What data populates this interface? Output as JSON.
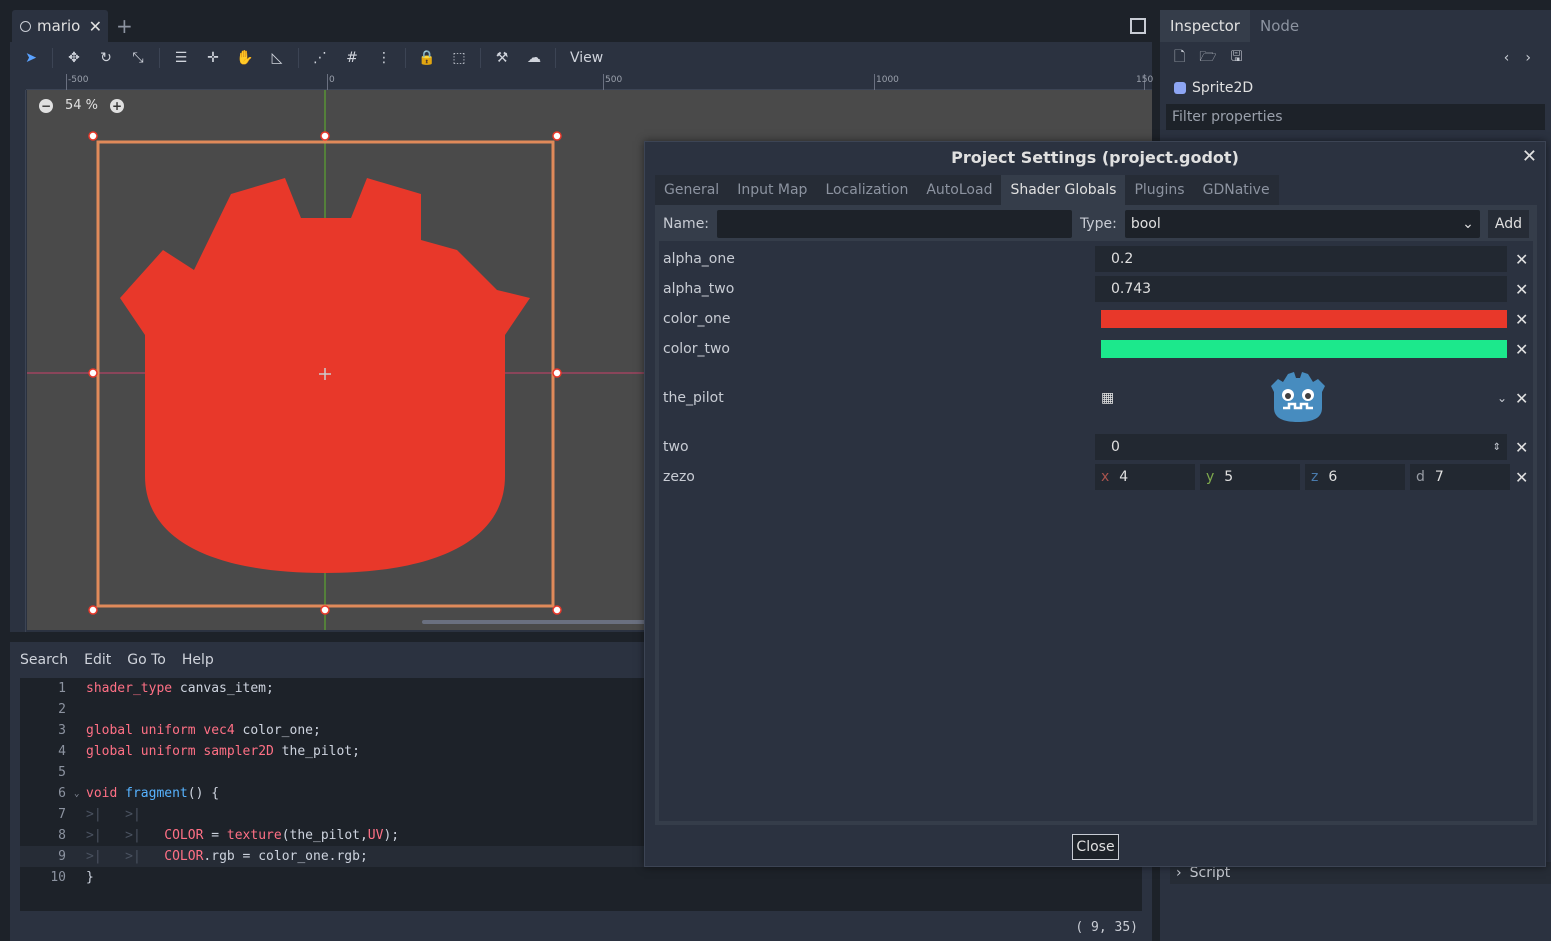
{
  "scene_tab": {
    "name": "mario"
  },
  "toolbar": {
    "view_label": "View"
  },
  "ruler": {
    "labels": [
      "-500",
      "0",
      "500",
      "1000",
      "150"
    ]
  },
  "viewport": {
    "zoom": "54 %"
  },
  "code_menu": [
    "Search",
    "Edit",
    "Go To",
    "Help"
  ],
  "code": {
    "lines": [
      {
        "n": "1"
      },
      {
        "n": "2"
      },
      {
        "n": "3"
      },
      {
        "n": "4"
      },
      {
        "n": "5"
      },
      {
        "n": "6"
      },
      {
        "n": "7"
      },
      {
        "n": "8"
      },
      {
        "n": "9"
      },
      {
        "n": "10"
      }
    ],
    "t1a": "shader_type",
    "t1b": " canvas_item;",
    "t3a": "global uniform",
    "t3b": "vec4",
    "t3c": " color_one;",
    "t4a": "global uniform",
    "t4b": "sampler2D",
    "t4c": " the_pilot;",
    "t6a": "void",
    "t6b": "fragment",
    "t6c": "() {",
    "t8a": "COLOR",
    "t8b": " = ",
    "t8c": "texture",
    "t8d": "(the_pilot,",
    "t8e": "UV",
    "t8f": ");",
    "t9a": "COLOR",
    "t9b": ".rgb = color_one.rgb;",
    "t10": "}"
  },
  "status": {
    "cursor": "(   9,  35)"
  },
  "inspector": {
    "tabs": [
      "Inspector",
      "Node"
    ],
    "node_name": "Sprite2D",
    "filter_placeholder": "Filter properties",
    "script_label": "Script"
  },
  "dialog": {
    "title": "Project Settings (project.godot)",
    "tabs": [
      "General",
      "Input Map",
      "Localization",
      "AutoLoad",
      "Shader Globals",
      "Plugins",
      "GDNative"
    ],
    "active_tab": "Shader Globals",
    "name_label": "Name:",
    "type_label": "Type:",
    "type_value": "bool",
    "add_label": "Add",
    "close_label": "Close",
    "vars": {
      "alpha_one": {
        "name": "alpha_one",
        "value": "0.2"
      },
      "alpha_two": {
        "name": "alpha_two",
        "value": "0.743"
      },
      "color_one": {
        "name": "color_one",
        "color": "#e8382a"
      },
      "color_two": {
        "name": "color_two",
        "color": "#1ce88c"
      },
      "the_pilot": {
        "name": "the_pilot"
      },
      "two": {
        "name": "two",
        "value": "0"
      },
      "zezo": {
        "name": "zezo",
        "x": "4",
        "y": "5",
        "z": "6",
        "d": "7",
        "axis_x": "x",
        "axis_y": "y",
        "axis_z": "z",
        "axis_d": "d"
      }
    }
  },
  "colors": {
    "accent": "#5aa2ff",
    "sprite_red": "#e8382a",
    "selection_orange": "#e08a5a"
  }
}
